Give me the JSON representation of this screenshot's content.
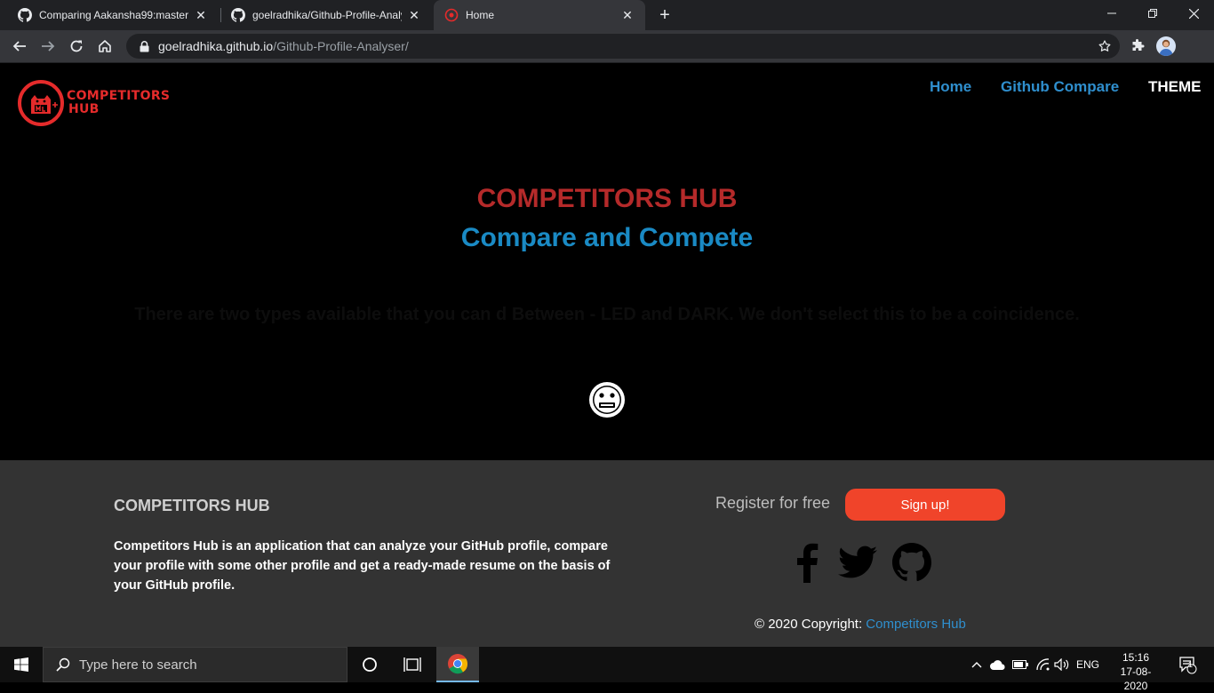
{
  "browser": {
    "tabs": [
      {
        "title": "Comparing Aakansha99:master...",
        "icon": "github-icon"
      },
      {
        "title": "goelradhika/Github-Profile-Analy",
        "icon": "github-icon"
      },
      {
        "title": "Home",
        "icon": "competitors-hub-favicon"
      }
    ],
    "url_host": "goelradhika.github.io",
    "url_path": "/Github-Profile-Analyser/"
  },
  "site": {
    "logo": {
      "line1": "COMPETITORS",
      "line2": "HUB"
    },
    "nav": {
      "home": "Home",
      "compare": "Github Compare",
      "theme": "THEME"
    },
    "hero": {
      "title": "COMPETITORS HUB",
      "subtitle": "Compare and Compete",
      "faint_text": "There are two types available that you can  d Between - LED and DARK. We don't select this to be a coincidence."
    }
  },
  "footer": {
    "brand": "COMPETITORS HUB",
    "description": "Competitors Hub is an application that can analyze your GitHub profile, compare your profile with some other profile and get a ready-made resume on the basis of your GitHub profile.",
    "register_text": "Register for free",
    "signup_label": "Sign up!",
    "copyright_prefix": "© 2020 Copyright:",
    "copyright_link": "Competitors Hub"
  },
  "taskbar": {
    "search_placeholder": "Type here to search",
    "language": "ENG",
    "time": "15:16",
    "date": "17-08-2020",
    "notification_count": "1"
  },
  "colors": {
    "brand_red": "#b52a2a",
    "brand_blue": "#1a8ac4",
    "signup": "#f0442a",
    "footer_bg": "#333333"
  }
}
